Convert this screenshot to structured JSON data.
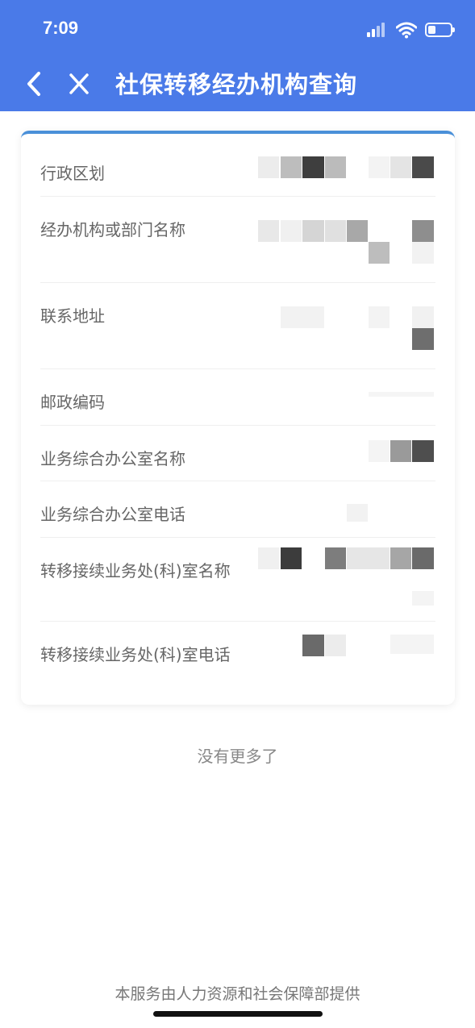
{
  "status_bar": {
    "time": "7:09",
    "icons": [
      "signal-icon",
      "wifi-icon",
      "battery-icon"
    ]
  },
  "nav": {
    "title": "社保转移经办机构查询",
    "back_icon": "chevron-left-icon",
    "close_icon": "close-icon"
  },
  "rows": [
    {
      "label": "行政区划"
    },
    {
      "label": "经办机构或部门名称"
    },
    {
      "label": "联系地址"
    },
    {
      "label": "邮政编码"
    },
    {
      "label": "业务综合办公室名称"
    },
    {
      "label": "业务综合办公室电话"
    },
    {
      "label": "转移接续业务处(科)室名称"
    },
    {
      "label": "转移接续业务处(科)室电话"
    }
  ],
  "end_text": "没有更多了",
  "footer_text": "本服务由人力资源和社会保障部提供",
  "colors": {
    "header": "#4a7ae8",
    "card_accent": "#4a90d9",
    "label": "#666666"
  }
}
